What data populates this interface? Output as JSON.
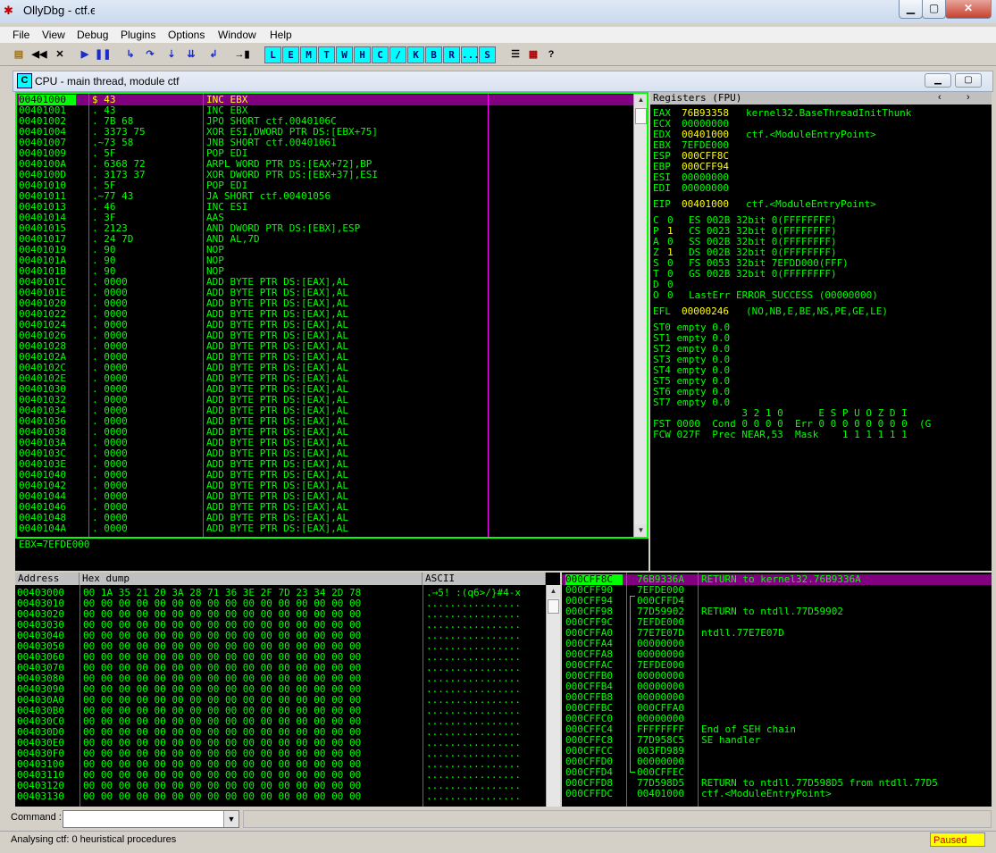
{
  "window": {
    "title": "OllyDbg - ctf.exe",
    "icon": "bug-icon"
  },
  "menu": [
    "File",
    "View",
    "Debug",
    "Plugins",
    "Options",
    "Window",
    "Help"
  ],
  "toolbar": {
    "letter_buttons": [
      "L",
      "E",
      "M",
      "T",
      "W",
      "H",
      "C",
      "/",
      "K",
      "B",
      "R",
      "...",
      "S"
    ]
  },
  "cpu_window": {
    "title": "CPU - main thread, module ctf",
    "icon_letter": "C"
  },
  "disasm": {
    "rows": [
      {
        "addr": "00401000",
        "hex": "$ 43",
        "asm": "INC EBX"
      },
      {
        "addr": "00401001",
        "hex": ". 43",
        "asm": "INC EBX"
      },
      {
        "addr": "00401002",
        "hex": ". 7B 68",
        "asm": "JPO SHORT ctf.0040106C"
      },
      {
        "addr": "00401004",
        "hex": ". 3373 75",
        "asm": "XOR ESI,DWORD PTR DS:[EBX+75]"
      },
      {
        "addr": "00401007",
        "hex": ".~73 58",
        "asm": "JNB SHORT ctf.00401061"
      },
      {
        "addr": "00401009",
        "hex": ". 5F",
        "asm": "POP EDI"
      },
      {
        "addr": "0040100A",
        "hex": ". 6368 72",
        "asm": "ARPL WORD PTR DS:[EAX+72],BP"
      },
      {
        "addr": "0040100D",
        "hex": ". 3173 37",
        "asm": "XOR DWORD PTR DS:[EBX+37],ESI"
      },
      {
        "addr": "00401010",
        "hex": ". 5F",
        "asm": "POP EDI"
      },
      {
        "addr": "00401011",
        "hex": ".~77 43",
        "asm": "JA SHORT ctf.00401056"
      },
      {
        "addr": "00401013",
        "hex": ". 46",
        "asm": "INC ESI"
      },
      {
        "addr": "00401014",
        "hex": ". 3F",
        "asm": "AAS"
      },
      {
        "addr": "00401015",
        "hex": ". 2123",
        "asm": "AND DWORD PTR DS:[EBX],ESP"
      },
      {
        "addr": "00401017",
        "hex": ". 24 7D",
        "asm": "AND AL,7D"
      },
      {
        "addr": "00401019",
        "hex": ". 90",
        "asm": "NOP"
      },
      {
        "addr": "0040101A",
        "hex": ". 90",
        "asm": "NOP"
      },
      {
        "addr": "0040101B",
        "hex": ". 90",
        "asm": "NOP"
      },
      {
        "addr": "0040101C",
        "hex": ". 0000",
        "asm": "ADD BYTE PTR DS:[EAX],AL"
      },
      {
        "addr": "0040101E",
        "hex": ". 0000",
        "asm": "ADD BYTE PTR DS:[EAX],AL"
      },
      {
        "addr": "00401020",
        "hex": ". 0000",
        "asm": "ADD BYTE PTR DS:[EAX],AL"
      },
      {
        "addr": "00401022",
        "hex": ". 0000",
        "asm": "ADD BYTE PTR DS:[EAX],AL"
      },
      {
        "addr": "00401024",
        "hex": ". 0000",
        "asm": "ADD BYTE PTR DS:[EAX],AL"
      },
      {
        "addr": "00401026",
        "hex": ". 0000",
        "asm": "ADD BYTE PTR DS:[EAX],AL"
      },
      {
        "addr": "00401028",
        "hex": ". 0000",
        "asm": "ADD BYTE PTR DS:[EAX],AL"
      },
      {
        "addr": "0040102A",
        "hex": ". 0000",
        "asm": "ADD BYTE PTR DS:[EAX],AL"
      },
      {
        "addr": "0040102C",
        "hex": ". 0000",
        "asm": "ADD BYTE PTR DS:[EAX],AL"
      },
      {
        "addr": "0040102E",
        "hex": ". 0000",
        "asm": "ADD BYTE PTR DS:[EAX],AL"
      },
      {
        "addr": "00401030",
        "hex": ". 0000",
        "asm": "ADD BYTE PTR DS:[EAX],AL"
      },
      {
        "addr": "00401032",
        "hex": ". 0000",
        "asm": "ADD BYTE PTR DS:[EAX],AL"
      },
      {
        "addr": "00401034",
        "hex": ". 0000",
        "asm": "ADD BYTE PTR DS:[EAX],AL"
      },
      {
        "addr": "00401036",
        "hex": ". 0000",
        "asm": "ADD BYTE PTR DS:[EAX],AL"
      },
      {
        "addr": "00401038",
        "hex": ". 0000",
        "asm": "ADD BYTE PTR DS:[EAX],AL"
      },
      {
        "addr": "0040103A",
        "hex": ". 0000",
        "asm": "ADD BYTE PTR DS:[EAX],AL"
      },
      {
        "addr": "0040103C",
        "hex": ". 0000",
        "asm": "ADD BYTE PTR DS:[EAX],AL"
      },
      {
        "addr": "0040103E",
        "hex": ". 0000",
        "asm": "ADD BYTE PTR DS:[EAX],AL"
      },
      {
        "addr": "00401040",
        "hex": ". 0000",
        "asm": "ADD BYTE PTR DS:[EAX],AL"
      },
      {
        "addr": "00401042",
        "hex": ". 0000",
        "asm": "ADD BYTE PTR DS:[EAX],AL"
      },
      {
        "addr": "00401044",
        "hex": ". 0000",
        "asm": "ADD BYTE PTR DS:[EAX],AL"
      },
      {
        "addr": "00401046",
        "hex": ". 0000",
        "asm": "ADD BYTE PTR DS:[EAX],AL"
      },
      {
        "addr": "00401048",
        "hex": ". 0000",
        "asm": "ADD BYTE PTR DS:[EAX],AL"
      },
      {
        "addr": "0040104A",
        "hex": ". 0000",
        "asm": "ADD BYTE PTR DS:[EAX],AL"
      }
    ],
    "info_line": "EBX=7EFDE000"
  },
  "registers": {
    "header": "Registers (FPU)",
    "lines": [
      {
        "name": "EAX",
        "value": "76B93358",
        "hl": true,
        "comment": "kernel32.BaseThreadInitThunk"
      },
      {
        "name": "ECX",
        "value": "00000000",
        "hl": false,
        "comment": ""
      },
      {
        "name": "EDX",
        "value": "00401000",
        "hl": true,
        "comment": "ctf.<ModuleEntryPoint>"
      },
      {
        "name": "EBX",
        "value": "7EFDE000",
        "hl": false,
        "comment": ""
      },
      {
        "name": "ESP",
        "value": "000CFF8C",
        "hl": true,
        "comment": ""
      },
      {
        "name": "EBP",
        "value": "000CFF94",
        "hl": true,
        "comment": ""
      },
      {
        "name": "ESI",
        "value": "00000000",
        "hl": false,
        "comment": ""
      },
      {
        "name": "EDI",
        "value": "00000000",
        "hl": false,
        "comment": ""
      },
      {
        "name": "",
        "value": "",
        "hl": false,
        "comment": ""
      },
      {
        "name": "EIP",
        "value": "00401000",
        "hl": true,
        "comment": "ctf.<ModuleEntryPoint>"
      }
    ],
    "flags": [
      {
        "f": "C",
        "v": "0",
        "rest": "ES 002B 32bit 0(FFFFFFFF)"
      },
      {
        "f": "P",
        "v": "1",
        "rest": "CS 0023 32bit 0(FFFFFFFF)"
      },
      {
        "f": "A",
        "v": "0",
        "rest": "SS 002B 32bit 0(FFFFFFFF)"
      },
      {
        "f": "Z",
        "v": "1",
        "rest": "DS 002B 32bit 0(FFFFFFFF)"
      },
      {
        "f": "S",
        "v": "0",
        "rest": "FS 0053 32bit 7EFDD000(FFF)"
      },
      {
        "f": "T",
        "v": "0",
        "rest": "GS 002B 32bit 0(FFFFFFFF)"
      },
      {
        "f": "D",
        "v": "0",
        "rest": ""
      },
      {
        "f": "O",
        "v": "0",
        "rest": "LastErr ERROR_SUCCESS (00000000)"
      }
    ],
    "efl_label": "EFL",
    "efl_value": "00000246",
    "efl_comment": "(NO,NB,E,BE,NS,PE,GE,LE)",
    "fpu": [
      "ST0 empty 0.0",
      "ST1 empty 0.0",
      "ST2 empty 0.0",
      "ST3 empty 0.0",
      "ST4 empty 0.0",
      "ST5 empty 0.0",
      "ST6 empty 0.0",
      "ST7 empty 0.0"
    ],
    "fpu_tail": [
      "               3 2 1 0      E S P U O Z D I",
      "FST 0000  Cond 0 0 0 0  Err 0 0 0 0 0 0 0 0  (G",
      "FCW 027F  Prec NEAR,53  Mask    1 1 1 1 1 1"
    ]
  },
  "dump": {
    "headers": {
      "address": "Address",
      "hex": "Hex dump",
      "ascii": "ASCII"
    },
    "rows": [
      {
        "addr": "00403000",
        "hex": "00 1A 35 21 20 3A 28 71 36 3E 2F 7D 23 34 2D 78",
        "ascii": ".→5! :(q6>/}#4-x"
      },
      {
        "addr": "00403010",
        "hex": "00 00 00 00 00 00 00 00 00 00 00 00 00 00 00 00",
        "ascii": "................"
      },
      {
        "addr": "00403020",
        "hex": "00 00 00 00 00 00 00 00 00 00 00 00 00 00 00 00",
        "ascii": "................"
      },
      {
        "addr": "00403030",
        "hex": "00 00 00 00 00 00 00 00 00 00 00 00 00 00 00 00",
        "ascii": "................"
      },
      {
        "addr": "00403040",
        "hex": "00 00 00 00 00 00 00 00 00 00 00 00 00 00 00 00",
        "ascii": "................"
      },
      {
        "addr": "00403050",
        "hex": "00 00 00 00 00 00 00 00 00 00 00 00 00 00 00 00",
        "ascii": "................"
      },
      {
        "addr": "00403060",
        "hex": "00 00 00 00 00 00 00 00 00 00 00 00 00 00 00 00",
        "ascii": "................"
      },
      {
        "addr": "00403070",
        "hex": "00 00 00 00 00 00 00 00 00 00 00 00 00 00 00 00",
        "ascii": "................"
      },
      {
        "addr": "00403080",
        "hex": "00 00 00 00 00 00 00 00 00 00 00 00 00 00 00 00",
        "ascii": "................"
      },
      {
        "addr": "00403090",
        "hex": "00 00 00 00 00 00 00 00 00 00 00 00 00 00 00 00",
        "ascii": "................"
      },
      {
        "addr": "004030A0",
        "hex": "00 00 00 00 00 00 00 00 00 00 00 00 00 00 00 00",
        "ascii": "................"
      },
      {
        "addr": "004030B0",
        "hex": "00 00 00 00 00 00 00 00 00 00 00 00 00 00 00 00",
        "ascii": "................"
      },
      {
        "addr": "004030C0",
        "hex": "00 00 00 00 00 00 00 00 00 00 00 00 00 00 00 00",
        "ascii": "................"
      },
      {
        "addr": "004030D0",
        "hex": "00 00 00 00 00 00 00 00 00 00 00 00 00 00 00 00",
        "ascii": "................"
      },
      {
        "addr": "004030E0",
        "hex": "00 00 00 00 00 00 00 00 00 00 00 00 00 00 00 00",
        "ascii": "................"
      },
      {
        "addr": "004030F0",
        "hex": "00 00 00 00 00 00 00 00 00 00 00 00 00 00 00 00",
        "ascii": "................"
      },
      {
        "addr": "00403100",
        "hex": "00 00 00 00 00 00 00 00 00 00 00 00 00 00 00 00",
        "ascii": "................"
      },
      {
        "addr": "00403110",
        "hex": "00 00 00 00 00 00 00 00 00 00 00 00 00 00 00 00",
        "ascii": "................"
      },
      {
        "addr": "00403120",
        "hex": "00 00 00 00 00 00 00 00 00 00 00 00 00 00 00 00",
        "ascii": "................"
      },
      {
        "addr": "00403130",
        "hex": "00 00 00 00 00 00 00 00 00 00 00 00 00 00 00 00",
        "ascii": "................"
      }
    ]
  },
  "stack": {
    "rows": [
      {
        "addr": "000CFF8C",
        "val": "76B9336A",
        "comment": "RETURN to kernel32.76B9336A"
      },
      {
        "addr": "000CFF90",
        "val": "7EFDE000",
        "comment": ""
      },
      {
        "addr": "000CFF94",
        "val": "000CFFD4",
        "comment": ""
      },
      {
        "addr": "000CFF98",
        "val": "77D59902",
        "comment": "RETURN to ntdll.77D59902"
      },
      {
        "addr": "000CFF9C",
        "val": "7EFDE000",
        "comment": ""
      },
      {
        "addr": "000CFFA0",
        "val": "77E7E07D",
        "comment": "ntdll.77E7E07D"
      },
      {
        "addr": "000CFFA4",
        "val": "00000000",
        "comment": ""
      },
      {
        "addr": "000CFFA8",
        "val": "00000000",
        "comment": ""
      },
      {
        "addr": "000CFFAC",
        "val": "7EFDE000",
        "comment": ""
      },
      {
        "addr": "000CFFB0",
        "val": "00000000",
        "comment": ""
      },
      {
        "addr": "000CFFB4",
        "val": "00000000",
        "comment": ""
      },
      {
        "addr": "000CFFB8",
        "val": "00000000",
        "comment": ""
      },
      {
        "addr": "000CFFBC",
        "val": "000CFFA0",
        "comment": ""
      },
      {
        "addr": "000CFFC0",
        "val": "00000000",
        "comment": ""
      },
      {
        "addr": "000CFFC4",
        "val": "FFFFFFFF",
        "comment": "End of SEH chain"
      },
      {
        "addr": "000CFFC8",
        "val": "77D958C5",
        "comment": "SE handler"
      },
      {
        "addr": "000CFFCC",
        "val": "003FD989",
        "comment": ""
      },
      {
        "addr": "000CFFD0",
        "val": "00000000",
        "comment": ""
      },
      {
        "addr": "000CFFD4",
        "val": "000CFFEC",
        "comment": ""
      },
      {
        "addr": "000CFFD8",
        "val": "77D598D5",
        "comment": "RETURN to ntdll.77D598D5 from ntdll.77D5"
      },
      {
        "addr": "000CFFDC",
        "val": "00401000",
        "comment": "ctf.<ModuleEntryPoint>"
      }
    ]
  },
  "command": {
    "label": "Command :",
    "value": ""
  },
  "status": {
    "message": "Analysing ctf: 0 heuristical procedures",
    "state": "Paused"
  },
  "colors": {
    "code_green": "#00ff00",
    "highlight_yellow": "#ffff00",
    "selection_purple": "#800080",
    "separator_magenta": "#ff00ff",
    "paused_bg": "#ffff00"
  }
}
